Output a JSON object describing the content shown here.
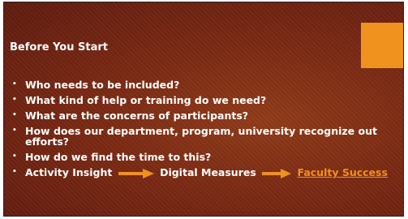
{
  "slide": {
    "title": "Before You Start",
    "bullets": [
      "Who needs to be included?",
      "What kind of help or training do we need?",
      "What are the concerns of participants?",
      "How does our department, program, university recognize out efforts?",
      "How do we find the time to this?"
    ],
    "last_bullet": {
      "part1": "Activity Insight",
      "part2": "Digital Measures",
      "link": "Faculty Success"
    },
    "bullet_symbol": "•",
    "colors": {
      "background": "#7a2812",
      "accent": "#f0921e",
      "text": "#ffffff",
      "link": "#f0921e"
    },
    "icons": [
      "arrow-right-icon",
      "arrow-right-icon"
    ]
  }
}
